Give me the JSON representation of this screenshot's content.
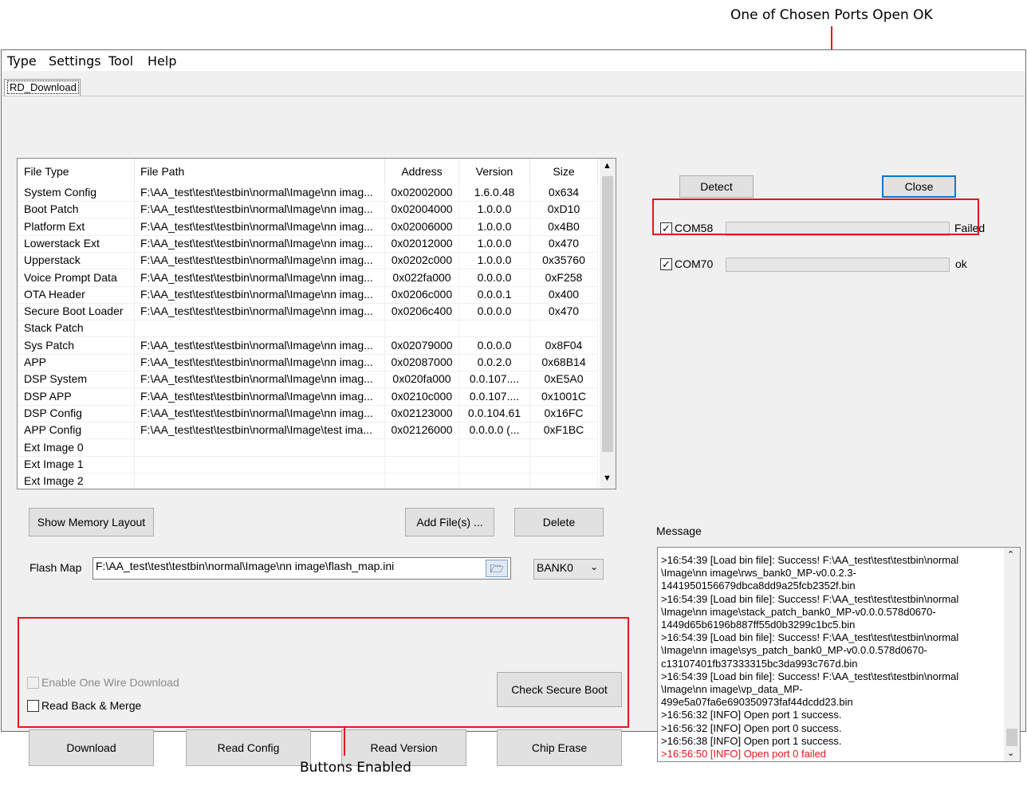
{
  "annotations": {
    "top": "One of Chosen Ports Open OK",
    "bottom": "Buttons Enabled"
  },
  "colors": {
    "annotation_red": "#e8141b",
    "error_text": "#e8141b",
    "accent": "#0078d7"
  },
  "menu": [
    "Type",
    "Settings",
    "Tool",
    "Help"
  ],
  "tab": "RD_Download",
  "table": {
    "headers": [
      "File Type",
      "File Path",
      "Address",
      "Version",
      "Size"
    ],
    "rows": [
      [
        "System Config",
        "F:\\AA_test\\test\\testbin\\normal\\Image\\nn imag...",
        "0x02002000",
        "1.6.0.48",
        "0x634"
      ],
      [
        "Boot Patch",
        "F:\\AA_test\\test\\testbin\\normal\\Image\\nn imag...",
        "0x02004000",
        "1.0.0.0",
        "0xD10"
      ],
      [
        "Platform Ext",
        "F:\\AA_test\\test\\testbin\\normal\\Image\\nn imag...",
        "0x02006000",
        "1.0.0.0",
        "0x4B0"
      ],
      [
        "Lowerstack Ext",
        "F:\\AA_test\\test\\testbin\\normal\\Image\\nn imag...",
        "0x02012000",
        "1.0.0.0",
        "0x470"
      ],
      [
        "Upperstack",
        "F:\\AA_test\\test\\testbin\\normal\\Image\\nn imag...",
        "0x0202c000",
        "1.0.0.0",
        "0x35760"
      ],
      [
        "Voice Prompt Data",
        "F:\\AA_test\\test\\testbin\\normal\\Image\\nn imag...",
        "0x022fa000",
        "0.0.0.0",
        "0xF258"
      ],
      [
        "OTA Header",
        "F:\\AA_test\\test\\testbin\\normal\\Image\\nn imag...",
        "0x0206c000",
        "0.0.0.1",
        "0x400"
      ],
      [
        "Secure Boot Loader",
        "F:\\AA_test\\test\\testbin\\normal\\Image\\nn imag...",
        "0x0206c400",
        "0.0.0.0",
        "0x470"
      ],
      [
        "Stack Patch",
        "",
        "",
        "",
        ""
      ],
      [
        "Sys Patch",
        "F:\\AA_test\\test\\testbin\\normal\\Image\\nn imag...",
        "0x02079000",
        "0.0.0.0",
        "0x8F04"
      ],
      [
        "APP",
        "F:\\AA_test\\test\\testbin\\normal\\Image\\nn imag...",
        "0x02087000",
        "0.0.2.0",
        "0x68B14"
      ],
      [
        "DSP System",
        "F:\\AA_test\\test\\testbin\\normal\\Image\\nn imag...",
        "0x020fa000",
        "0.0.107....",
        "0xE5A0"
      ],
      [
        "DSP APP",
        "F:\\AA_test\\test\\testbin\\normal\\Image\\nn imag...",
        "0x0210c000",
        "0.0.107....",
        "0x1001C"
      ],
      [
        "DSP Config",
        "F:\\AA_test\\test\\testbin\\normal\\Image\\nn imag...",
        "0x02123000",
        "0.0.104.61",
        "0x16FC"
      ],
      [
        "APP Config",
        "F:\\AA_test\\test\\testbin\\normal\\Image\\test ima...",
        "0x02126000",
        "0.0.0.0 (...",
        "0xF1BC"
      ],
      [
        "Ext Image 0",
        "",
        "",
        "",
        ""
      ],
      [
        "Ext Image 1",
        "",
        "",
        "",
        ""
      ],
      [
        "Ext Image 2",
        "",
        "",
        "",
        ""
      ]
    ]
  },
  "buttons": {
    "show_memory_layout": "Show Memory Layout",
    "add_files": "Add File(s) ...",
    "delete": "Delete",
    "detect": "Detect",
    "close": "Close",
    "check_secure_boot": "Check Secure Boot",
    "download": "Download",
    "read_config": "Read Config",
    "read_version": "Read Version",
    "chip_erase": "Chip Erase"
  },
  "flash_map": {
    "label": "Flash Map",
    "path": "F:\\AA_test\\test\\testbin\\normal\\Image\\nn image\\flash_map.ini",
    "bank": "BANK0"
  },
  "ports": [
    {
      "name": "COM58",
      "checked": true,
      "status": "Failed"
    },
    {
      "name": "COM70",
      "checked": true,
      "status": "ok"
    }
  ],
  "options": {
    "one_wire": "Enable One Wire Download",
    "read_back": "Read Back & Merge"
  },
  "message": {
    "label": "Message",
    "lines": [
      {
        "text": ">16:54:39    [Load bin file]: Success! F:\\AA_test\\test\\testbin\\normal",
        "error": false
      },
      {
        "text": "\\Image\\nn image\\rws_bank0_MP-v0.0.2.3-",
        "error": false
      },
      {
        "text": "1441950156679dbca8dd9a25fcb2352f.bin",
        "error": false
      },
      {
        "text": ">16:54:39    [Load bin file]: Success! F:\\AA_test\\test\\testbin\\normal",
        "error": false
      },
      {
        "text": "\\Image\\nn image\\stack_patch_bank0_MP-v0.0.0.578d0670-",
        "error": false
      },
      {
        "text": "1449d65b6196b887ff55d0b3299c1bc5.bin",
        "error": false
      },
      {
        "text": ">16:54:39    [Load bin file]: Success! F:\\AA_test\\test\\testbin\\normal",
        "error": false
      },
      {
        "text": "\\Image\\nn image\\sys_patch_bank0_MP-v0.0.0.578d0670-",
        "error": false
      },
      {
        "text": "c13107401fb37333315bc3da993c767d.bin",
        "error": false
      },
      {
        "text": ">16:54:39    [Load bin file]: Success! F:\\AA_test\\test\\testbin\\normal",
        "error": false
      },
      {
        "text": "\\Image\\nn image\\vp_data_MP-",
        "error": false
      },
      {
        "text": "499e5a07fa6e690350973faf44dcdd23.bin",
        "error": false
      },
      {
        "text": ">16:56:32    [INFO] Open port 1 success.",
        "error": false
      },
      {
        "text": ">16:56:32    [INFO] Open port 0 success.",
        "error": false
      },
      {
        "text": ">16:56:38    [INFO] Open port 1 success.",
        "error": false
      },
      {
        "text": ">16:56:50    [INFO] Open port 0 failed",
        "error": true
      }
    ]
  }
}
